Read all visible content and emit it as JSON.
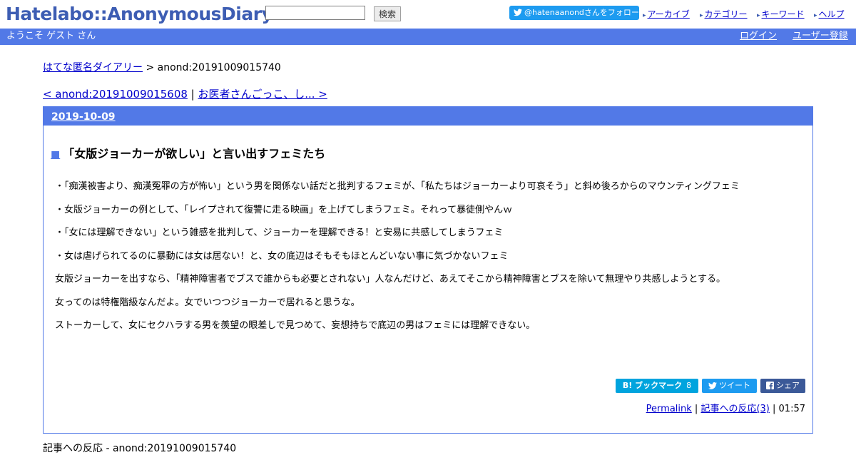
{
  "header": {
    "logo": "Hatelabo::AnonymousDiary",
    "search_button": "検索",
    "search_value": "",
    "twitter_follow": "@hatenaanondさんをフォロー",
    "nav": [
      "アーカイブ",
      "カテゴリー",
      "キーワード",
      "ヘルプ"
    ]
  },
  "bar": {
    "welcome": "ようこそ ゲスト さん",
    "login": "ログイン",
    "register": "ユーザー登録"
  },
  "breadcrumb": {
    "home": "はてな匿名ダイアリー",
    "separator": " > ",
    "current": "anond:20191009015740"
  },
  "entry_nav": {
    "prev": "< anond:20191009015608",
    "separator": " | ",
    "next": "お医者さんごっこ、し... >"
  },
  "day": {
    "date": "2019-10-09"
  },
  "entry": {
    "marker": "■",
    "title": "「女版ジョーカーが欲しい」と言い出すフェミたち",
    "paragraphs": [
      "・「痴漢被害より、痴漢冤罪の方が怖い」という男を関係ない話だと批判するフェミが、「私たちはジョーカーより可哀そう」と斜め後ろからのマウンティングフェミ",
      "・女版ジョーカーの例として、「レイプされて復讐に走る映画」を上げてしまうフェミ。それって暴徒側やんｗ",
      "・「女には理解できない」という雑感を批判して、ジョーカーを理解できる！と安易に共感してしまうフェミ",
      "・女は虐げられてるのに暴動には女は居ない！と、女の底辺はそもそもほとんどいない事に気づかないフェミ",
      "女版ジョーカーを出すなら、「精神障害者でブスで誰からも必要とされない」人なんだけど、あえてそこから精神障害とブスを除いて無理やり共感しようとする。",
      "女ってのは特権階級なんだよ。女でいつつジョーカーで居れると思うな。",
      "ストーカーして、女にセクハラする男を羨望の眼差しで見つめて、妄想持ちで底辺の男はフェミには理解できない。"
    ]
  },
  "share": {
    "bookmark_label": "B! ブックマーク",
    "bookmark_count": "8",
    "tweet": "ツイート",
    "facebook": "シェア"
  },
  "footer": {
    "permalink": "Permalink",
    "sep1": " | ",
    "reactions_link": "記事への反応(3)",
    "sep2": " | ",
    "time": "01:57"
  },
  "reactions_heading": "記事への反応 - anond:20191009015740",
  "colors": {
    "accent_blue": "#5279e7",
    "logo_blue": "#3d5db3",
    "twitter": "#1d9bf0",
    "hatena_bookmark": "#00a4de",
    "facebook": "#3b5998",
    "link": "#0000cc"
  }
}
